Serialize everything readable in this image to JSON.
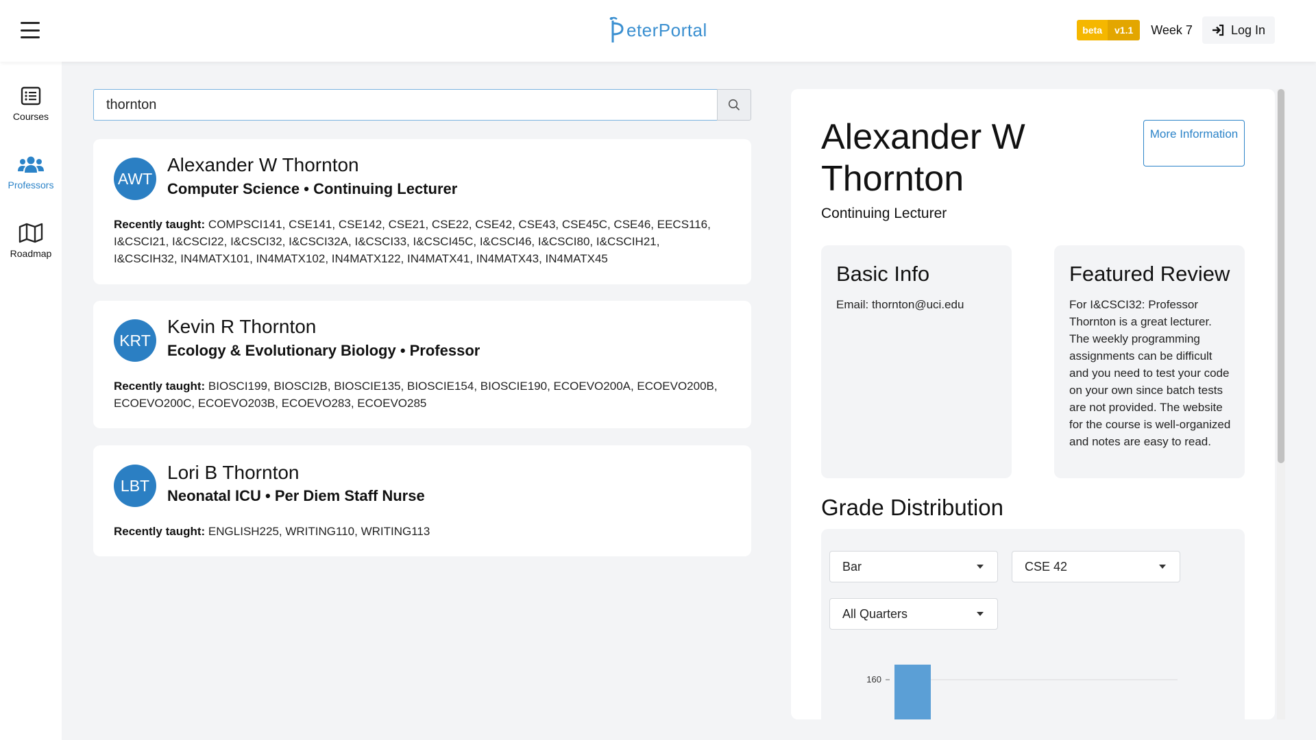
{
  "header": {
    "logo_text": "eterPortal",
    "badge_beta": "beta",
    "badge_version": "v1.1",
    "week": "Week 7",
    "login_label": "Log In"
  },
  "sidebar": {
    "items": [
      {
        "label": "Courses",
        "icon": "list-icon"
      },
      {
        "label": "Professors",
        "icon": "users-icon",
        "active": true
      },
      {
        "label": "Roadmap",
        "icon": "map-icon"
      }
    ]
  },
  "search": {
    "value": "thornton"
  },
  "results": [
    {
      "initials": "AWT",
      "name": "Alexander W Thornton",
      "department_title": "Computer Science • Continuing Lecturer",
      "taught_label": "Recently taught:",
      "taught": "COMPSCI141, CSE141, CSE142, CSE21, CSE22, CSE42, CSE43, CSE45C, CSE46, EECS116, I&CSCI21, I&CSCI22, I&CSCI32, I&CSCI32A, I&CSCI33, I&CSCI45C, I&CSCI46, I&CSCI80, I&CSCIH21, I&CSCIH32, IN4MATX101, IN4MATX102, IN4MATX122, IN4MATX41, IN4MATX43, IN4MATX45"
    },
    {
      "initials": "KRT",
      "name": "Kevin R Thornton",
      "department_title": "Ecology & Evolutionary Biology • Professor",
      "taught_label": "Recently taught:",
      "taught": "BIOSCI199, BIOSCI2B, BIOSCIE135, BIOSCIE154, BIOSCIE190, ECOEVO200A, ECOEVO200B, ECOEVO200C, ECOEVO203B, ECOEVO283, ECOEVO285"
    },
    {
      "initials": "LBT",
      "name": "Lori B Thornton",
      "department_title": "Neonatal ICU • Per Diem Staff Nurse",
      "taught_label": "Recently taught:",
      "taught": "ENGLISH225, WRITING110, WRITING113"
    }
  ],
  "detail": {
    "name": "Alexander W Thornton",
    "title": "Continuing Lecturer",
    "more_info_label": "More Information",
    "basic_info": {
      "heading": "Basic Info",
      "email": "Email: thornton@uci.edu"
    },
    "featured_review": {
      "heading": "Featured Review",
      "text": "For I&CSCI32: Professor Thornton is a great lecturer. The weekly programming assignments can be difficult and you need to test your code on your own since batch tests are not provided. The website for the course is well-organized and notes are easy to read."
    },
    "grade_distribution": {
      "heading": "Grade Distribution",
      "chart_type_select": "Bar",
      "course_select": "CSE 42",
      "quarter_select": "All Quarters"
    }
  },
  "colors": {
    "accent": "#2b83c8",
    "avatar": "#2b7fc3",
    "bar": "#5b9fd6",
    "beta": "#f5b700"
  },
  "chart_data": {
    "type": "bar",
    "yticks": [
      160
    ],
    "values": [
      160
    ],
    "series": []
  }
}
